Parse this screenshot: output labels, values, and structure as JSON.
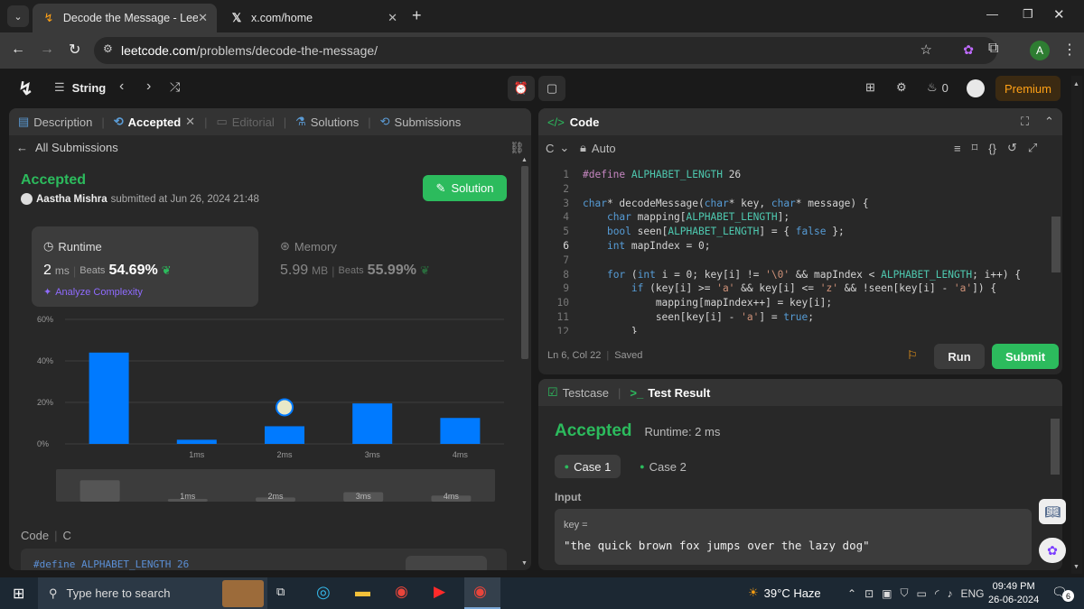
{
  "browser": {
    "tabs": [
      {
        "title": "Decode the Message - LeetCod",
        "active": true
      },
      {
        "title": "x.com/home",
        "active": false
      }
    ],
    "url_host": "leetcode.com",
    "url_path": "/problems/decode-the-message/",
    "profile_initial": "A"
  },
  "header": {
    "problem_list": "String",
    "streak": "0",
    "premium": "Premium"
  },
  "left": {
    "tabs": [
      "Description",
      "Accepted",
      "Editorial",
      "Solutions",
      "Submissions"
    ],
    "back_link": "All Submissions",
    "status": "Accepted",
    "author": "Aastha Mishra",
    "submitted": "submitted at Jun 26, 2024 21:48",
    "solution_btn": "Solution",
    "runtime": {
      "label": "Runtime",
      "value": "2",
      "unit": "ms",
      "beats_label": "Beats",
      "beats": "54.69%",
      "analyze": "Analyze Complexity"
    },
    "memory": {
      "label": "Memory",
      "value": "5.99",
      "unit": "MB",
      "beats_label": "Beats",
      "beats": "55.99%"
    },
    "code_label": "Code",
    "code_lang": "C",
    "code_preview": "#define ALPHABET_LENGTH 26"
  },
  "chart_data": {
    "type": "bar",
    "categories": [
      "",
      "1ms",
      "2ms",
      "3ms",
      "4ms"
    ],
    "values": [
      44,
      2,
      8.5,
      19.5,
      12.5
    ],
    "ylim": [
      0,
      60
    ],
    "yticks": [
      "60%",
      "40%",
      "20%",
      "0%"
    ],
    "grid": true,
    "highlight_index": 2,
    "colors": {
      "bar": "#007aff"
    }
  },
  "editor": {
    "title": "Code",
    "lang": "C",
    "mode": "Auto",
    "lines": [
      {
        "n": "1",
        "t": "#define ALPHABET_LENGTH 26"
      },
      {
        "n": "2",
        "t": ""
      },
      {
        "n": "3",
        "t": "char* decodeMessage(char* key, char* message) {"
      },
      {
        "n": "4",
        "t": "    char mapping[ALPHABET_LENGTH];"
      },
      {
        "n": "5",
        "t": "    bool seen[ALPHABET_LENGTH] = { false };"
      },
      {
        "n": "6",
        "t": "    int mapIndex = 0;"
      },
      {
        "n": "7",
        "t": ""
      },
      {
        "n": "8",
        "t": "    for (int i = 0; key[i] != '\\0' && mapIndex < ALPHABET_LENGTH; i++) {"
      },
      {
        "n": "9",
        "t": "        if (key[i] >= 'a' && key[i] <= 'z' && !seen[key[i] - 'a']) {"
      },
      {
        "n": "10",
        "t": "            mapping[mapIndex++] = key[i];"
      },
      {
        "n": "11",
        "t": "            seen[key[i] - 'a'] = true;"
      },
      {
        "n": "12",
        "t": "        }"
      }
    ],
    "status": "Ln 6, Col 22",
    "saved": "Saved",
    "run": "Run",
    "submit": "Submit"
  },
  "result": {
    "tab_testcase": "Testcase",
    "tab_result": "Test Result",
    "status": "Accepted",
    "runtime": "Runtime: 2 ms",
    "cases": [
      "Case 1",
      "Case 2"
    ],
    "input_label": "Input",
    "var_name": "key =",
    "var_value": "\"the quick brown fox jumps over the lazy dog\""
  },
  "taskbar": {
    "search_placeholder": "Type here to search",
    "weather": "39°C Haze",
    "lang": "ENG",
    "time": "09:49 PM",
    "date": "26-06-2024",
    "notif_count": "6"
  }
}
